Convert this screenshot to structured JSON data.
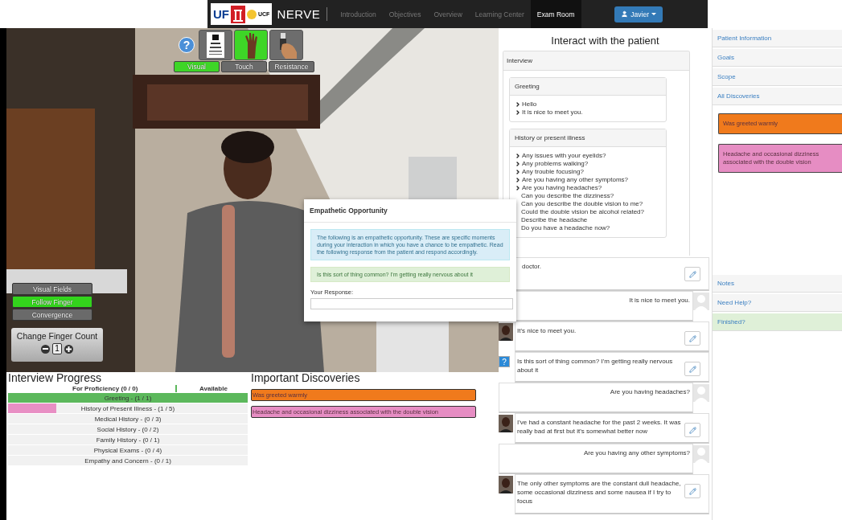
{
  "nav": {
    "logo_texts": [
      "UF",
      "UCF"
    ],
    "brand": "NERVE",
    "user": "Javier",
    "links": [
      {
        "label": "Introduction",
        "selected": false
      },
      {
        "label": "Objectives",
        "selected": false
      },
      {
        "label": "Overview",
        "selected": false
      },
      {
        "label": "Learning Center",
        "selected": false
      },
      {
        "label": "Exam Room",
        "selected": true
      }
    ]
  },
  "tools": {
    "help_label": "?",
    "items": [
      {
        "kind": "eye-chart",
        "selected": false
      },
      {
        "kind": "hand",
        "selected": true
      },
      {
        "kind": "instrument",
        "selected": false
      }
    ],
    "tabs": [
      {
        "label": "Visual",
        "selected": true
      },
      {
        "label": "Touch",
        "selected": false
      },
      {
        "label": "Resistance",
        "selected": false
      }
    ]
  },
  "exam_buttons": [
    {
      "label": "Visual Fields",
      "selected": false
    },
    {
      "label": "Follow Finger",
      "selected": true
    },
    {
      "label": "Convergence",
      "selected": false
    }
  ],
  "finger_count": {
    "title": "Change Finger Count",
    "value": "1"
  },
  "interview_progress": {
    "title": "Interview Progress",
    "proficiency": "For Proficiency  (0 / 0)",
    "available": "Available",
    "rows": [
      {
        "label": "Greeting - (1 / 1)",
        "level": 1,
        "color": "#5cb85c"
      },
      {
        "label": "History of Present Illness - (1 / 5)",
        "level": 0.2,
        "color": "#e88fc4"
      },
      {
        "label": "Medical History - (0 / 3)",
        "level": 0
      },
      {
        "label": "Social History - (0 / 2)",
        "level": 0
      },
      {
        "label": "Family History - (0 / 1)",
        "level": 0
      },
      {
        "label": "Physical Exams - (0 / 4)",
        "level": 0
      },
      {
        "label": "Empathy and Concern - (0 / 1)",
        "level": 0
      }
    ]
  },
  "important_discoveries": {
    "title": "Important Discoveries",
    "items": [
      {
        "text": "Was greeted warmly",
        "color": "#f07a1c"
      },
      {
        "text": "Headache and occasional dizziness associated with the double vision",
        "color": "#e68dc3"
      }
    ]
  },
  "interact": {
    "title": "Interact with the patient",
    "panel_title": "Interview",
    "sections": [
      {
        "title": "Greeting",
        "questions": [
          {
            "text": "Hello",
            "bullet": true
          },
          {
            "text": "It is nice to meet you.",
            "bullet": true
          }
        ]
      },
      {
        "title": "History or present illness",
        "questions": [
          {
            "text": "Any issues with your eyelids?",
            "bullet": true
          },
          {
            "text": "Any problems walking?",
            "bullet": true
          },
          {
            "text": "Any trouble focusing?",
            "bullet": true
          },
          {
            "text": "Are you having any other symptoms?",
            "bullet": true
          },
          {
            "text": "Are you having headaches?",
            "bullet": true
          },
          {
            "text": "Can you describe the dizziness?",
            "bullet": false
          },
          {
            "text": "Can you describe the double vision to me?",
            "bullet": false
          },
          {
            "text": "Could the double vision be alcohol related?",
            "bullet": false
          },
          {
            "text": "Describe the headache",
            "bullet": false
          },
          {
            "text": "Do you have a headache now?",
            "bullet": false
          }
        ]
      }
    ]
  },
  "dialog": {
    "title": "Empathetic Opportunity",
    "info": "The following is an empathetic opportunity. These are specific moments during your interaction in which you have a chance to be empathetic. Read the following response from the patient and respond accordingly.",
    "quote": "Is this sort of thing common? I'm getting really nervous about it",
    "response_label": "Your Response:"
  },
  "chat": [
    {
      "kind": "continued",
      "text": "doctor."
    },
    {
      "kind": "doctor",
      "text": "It is nice to meet you."
    },
    {
      "kind": "patient",
      "text": "It's nice to meet you."
    },
    {
      "kind": "empathetic",
      "text": "Is this sort of thing common? I'm getting really nervous about it",
      "icon_label": "?"
    },
    {
      "kind": "doctor",
      "text": "Are you having headaches?"
    },
    {
      "kind": "patient",
      "text": "I've had a constant headache for the past 2 weeks. It was really bad at first but it's somewhat better now"
    },
    {
      "kind": "doctor",
      "text": "Are you having any other symptoms?"
    },
    {
      "kind": "patient",
      "text": "The only other symptoms are the constant dull headache, some occasional dizziness and some nausea if I try to focus"
    }
  ],
  "sidebar": {
    "top_items": [
      {
        "label": "Patient Information",
        "highlighted": false
      },
      {
        "label": "Goals",
        "highlighted": false
      },
      {
        "label": "Scope",
        "highlighted": false
      },
      {
        "label": "All Discoveries",
        "highlighted": false
      }
    ],
    "discoveries": [
      {
        "text": "Was greeted warmly",
        "color": "#f07a1c"
      },
      {
        "text": "Headache and occasional dizziness associated with the double vision",
        "color": "#e68dc3"
      }
    ],
    "bottom_items": [
      {
        "label": "Notes",
        "highlighted": false
      },
      {
        "label": "Need Help?",
        "highlighted": false
      },
      {
        "label": "Finished?",
        "highlighted": true
      }
    ]
  }
}
